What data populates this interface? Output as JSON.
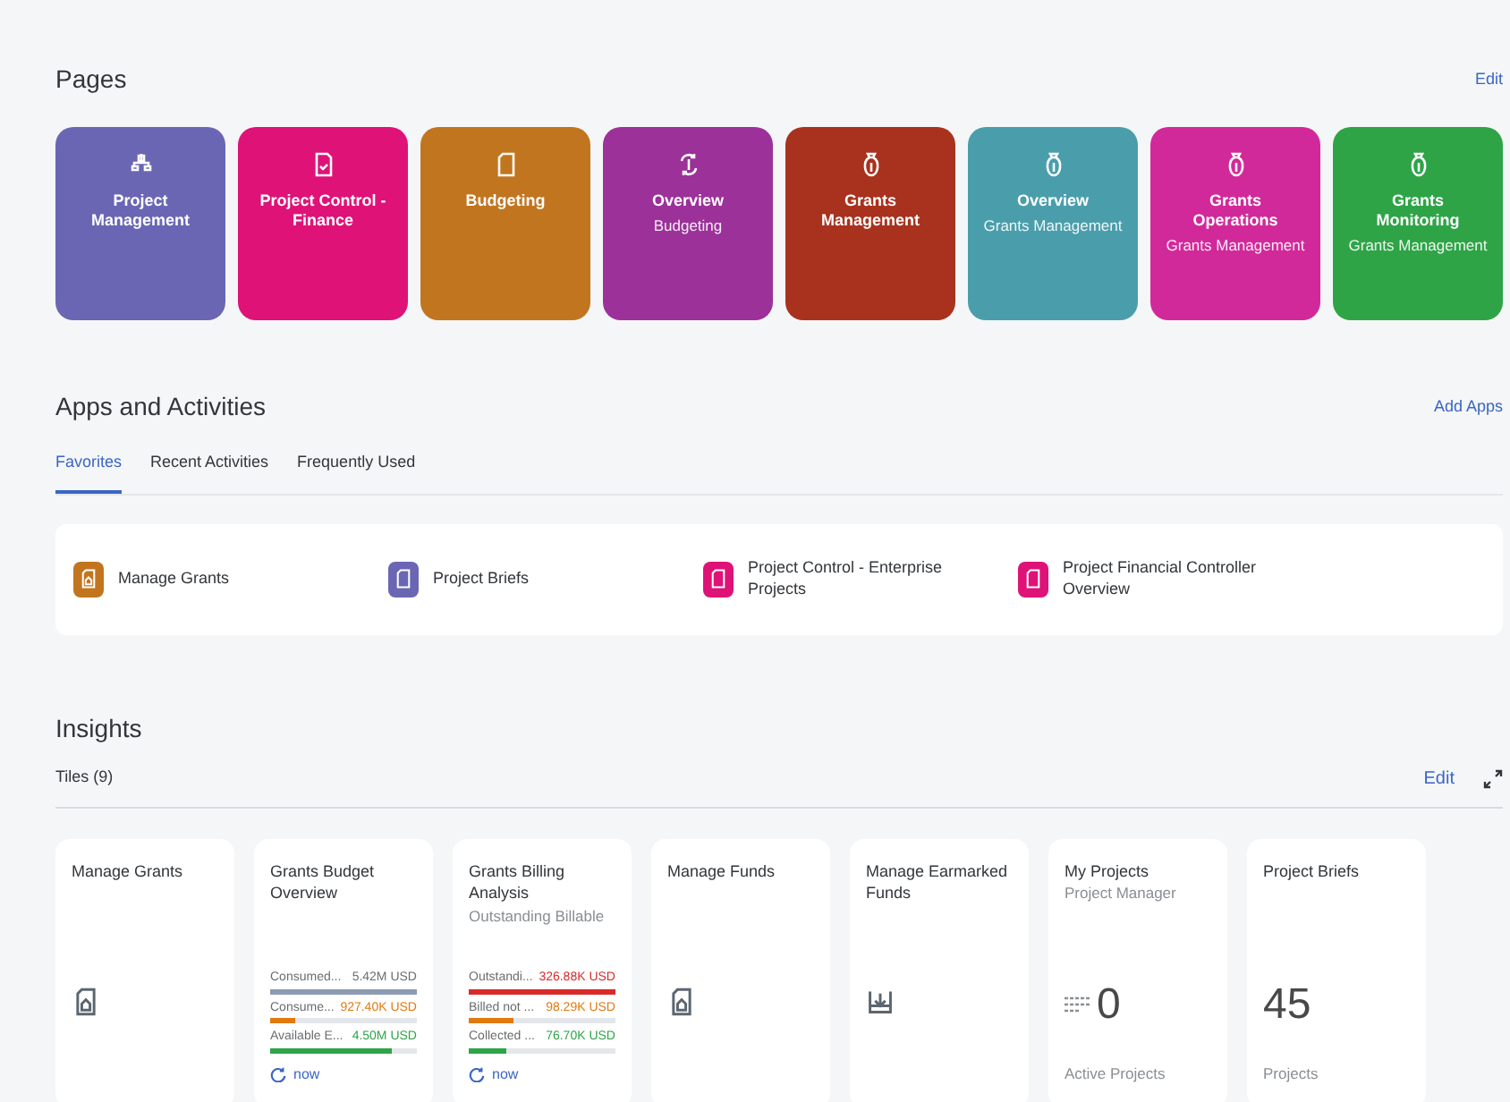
{
  "pages": {
    "title": "Pages",
    "edit": "Edit",
    "tiles": [
      {
        "kind": "hierarchy",
        "title": "Project Management",
        "color": "#6a66b4"
      },
      {
        "kind": "doc-check",
        "title": "Project Control - Finance",
        "color": "#df1278"
      },
      {
        "kind": "doc",
        "title": "Budgeting",
        "color": "#c2751f"
      },
      {
        "kind": "cycle",
        "title": "Overview",
        "subtitle": "Budgeting",
        "color": "#9b3199"
      },
      {
        "kind": "bag",
        "title": "Grants Management",
        "color": "#a8321e"
      },
      {
        "kind": "bag",
        "title": "Overview",
        "subtitle": "Grants Management",
        "color": "#4a9eab"
      },
      {
        "kind": "bag",
        "title": "Grants Operations",
        "subtitle": "Grants Management",
        "color": "#d2299a"
      },
      {
        "kind": "bag",
        "title": "Grants Monitoring",
        "subtitle": "Grants Management",
        "color": "#2ea447"
      }
    ]
  },
  "apps": {
    "title": "Apps and Activities",
    "add": "Add Apps",
    "tabs": [
      {
        "label": "Favorites",
        "selected": true
      },
      {
        "label": "Recent Activities",
        "selected": false
      },
      {
        "label": "Frequently Used",
        "selected": false
      }
    ],
    "items": [
      {
        "kind": "grant",
        "label": "Manage Grants",
        "color": "#c2751f"
      },
      {
        "kind": "doc",
        "label": "Project Briefs",
        "color": "#6a66b4"
      },
      {
        "kind": "doc",
        "label": "Project Control - Enterprise Projects",
        "color": "#df1278"
      },
      {
        "kind": "doc",
        "label": "Project Financial Controller Overview",
        "color": "#df1278"
      }
    ]
  },
  "insights": {
    "title": "Insights",
    "count": "Tiles (9)",
    "edit": "Edit",
    "tiles": [
      {
        "kind": "grant-app",
        "title": "Manage Grants"
      },
      {
        "kind": "kpi",
        "title": "Grants Budget Overview",
        "refresh": "now",
        "rows": [
          {
            "label": "Consumed...",
            "value": "5.42M USD",
            "level": 1,
            "color": "#8d9ab4"
          },
          {
            "label": "Consume...",
            "value": "927.40K USD",
            "level": 0.17,
            "color": "#e07a10"
          },
          {
            "label": "Available E...",
            "value": "4.50M USD",
            "level": 0.83,
            "color": "#2ea447"
          }
        ]
      },
      {
        "kind": "kpi",
        "title": "Grants Billing Analysis",
        "subtitle": "Outstanding Billable",
        "refresh": "now",
        "rows": [
          {
            "label": "Outstandi...",
            "value": "326.88K USD",
            "level": 1,
            "color": "#d92a2a"
          },
          {
            "label": "Billed not ...",
            "value": "98.29K USD",
            "level": 0.3,
            "color": "#e07a10"
          },
          {
            "label": "Collected ...",
            "value": "76.70K USD",
            "level": 0.25,
            "color": "#2ea447"
          }
        ]
      },
      {
        "kind": "grant-app",
        "title": "Manage Funds"
      },
      {
        "kind": "download-app",
        "title": "Manage Earmarked Funds"
      },
      {
        "kind": "list-count",
        "title": "My Projects",
        "subtitle": "Project Manager",
        "number": "0",
        "footer": "Active Projects"
      },
      {
        "kind": "count",
        "title": "Project Briefs",
        "number": "45",
        "footer": "Projects"
      }
    ]
  }
}
